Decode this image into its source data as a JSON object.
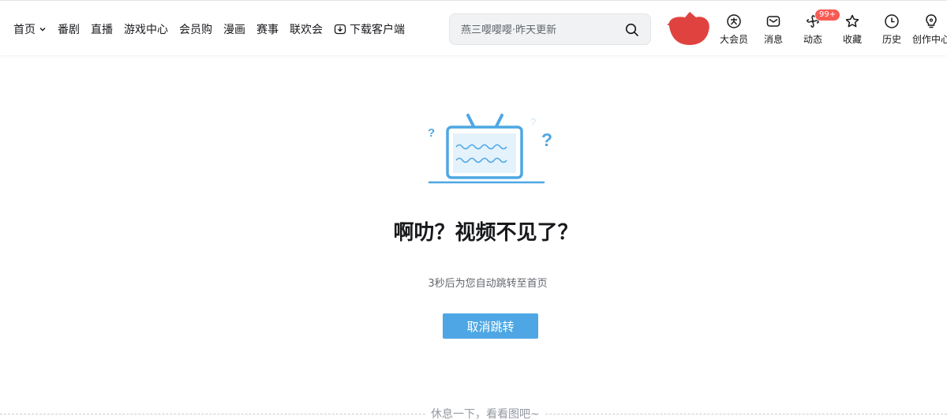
{
  "header": {
    "nav": {
      "home": "首页",
      "items": [
        "番剧",
        "直播",
        "游戏中心",
        "会员购",
        "漫画",
        "赛事",
        "联欢会"
      ],
      "download": "下载客户端"
    },
    "search": {
      "placeholder": "燕三嘤嘤嘤·昨天更新"
    },
    "entries": [
      {
        "label": "大会员",
        "icon": "vip-icon"
      },
      {
        "label": "消息",
        "icon": "message-icon"
      },
      {
        "label": "动态",
        "icon": "dynamic-icon",
        "badge": "99+"
      },
      {
        "label": "收藏",
        "icon": "star-icon"
      },
      {
        "label": "历史",
        "icon": "clock-icon"
      },
      {
        "label": "创作中心",
        "icon": "bulb-icon"
      }
    ]
  },
  "main": {
    "title": "啊叻？视频不见了？",
    "subtitle": "3秒后为您自动跳转至首页",
    "cancel_button": "取消跳转",
    "footer": "休息一下，看看图吧~"
  },
  "colors": {
    "accent": "#4ea7e4",
    "badge": "#f85a54",
    "avatar": "#e0433f"
  }
}
